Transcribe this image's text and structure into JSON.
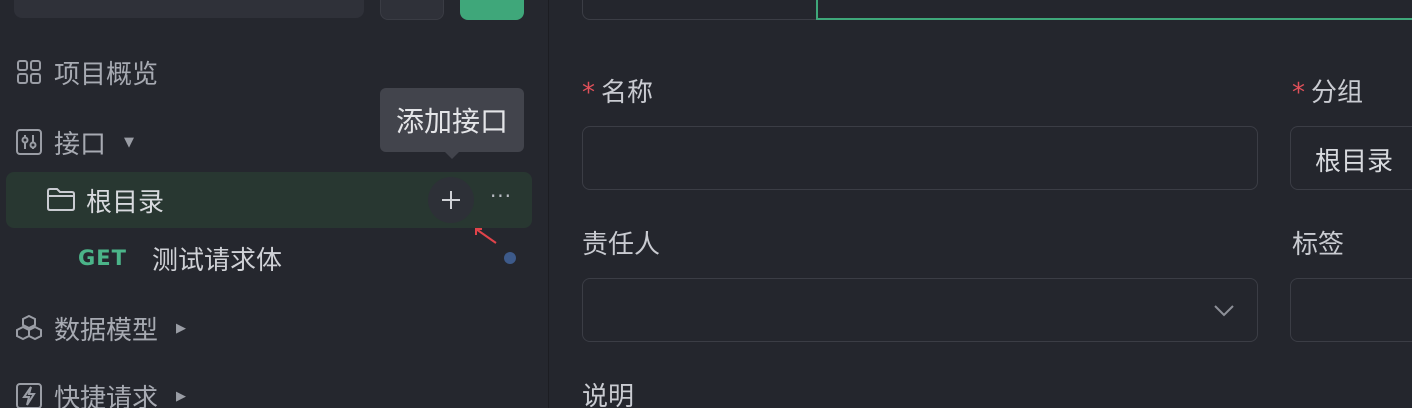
{
  "sidebar": {
    "project_overview": "项目概览",
    "interfaces": "接口",
    "root_folder": "根目录",
    "add_tooltip": "添加接口",
    "more_label": "···",
    "api_item": {
      "method": "GET",
      "name": "测试请求体"
    },
    "data_models": "数据模型",
    "quick_requests": "快捷请求"
  },
  "form": {
    "name_label": "名称",
    "group_label": "分组",
    "group_value": "根目录",
    "owner_label": "责任人",
    "tags_label": "标签",
    "description_label": "说明"
  },
  "colors": {
    "accent": "#3fa77a",
    "required": "#e0505a",
    "get_method": "#4bb489"
  }
}
